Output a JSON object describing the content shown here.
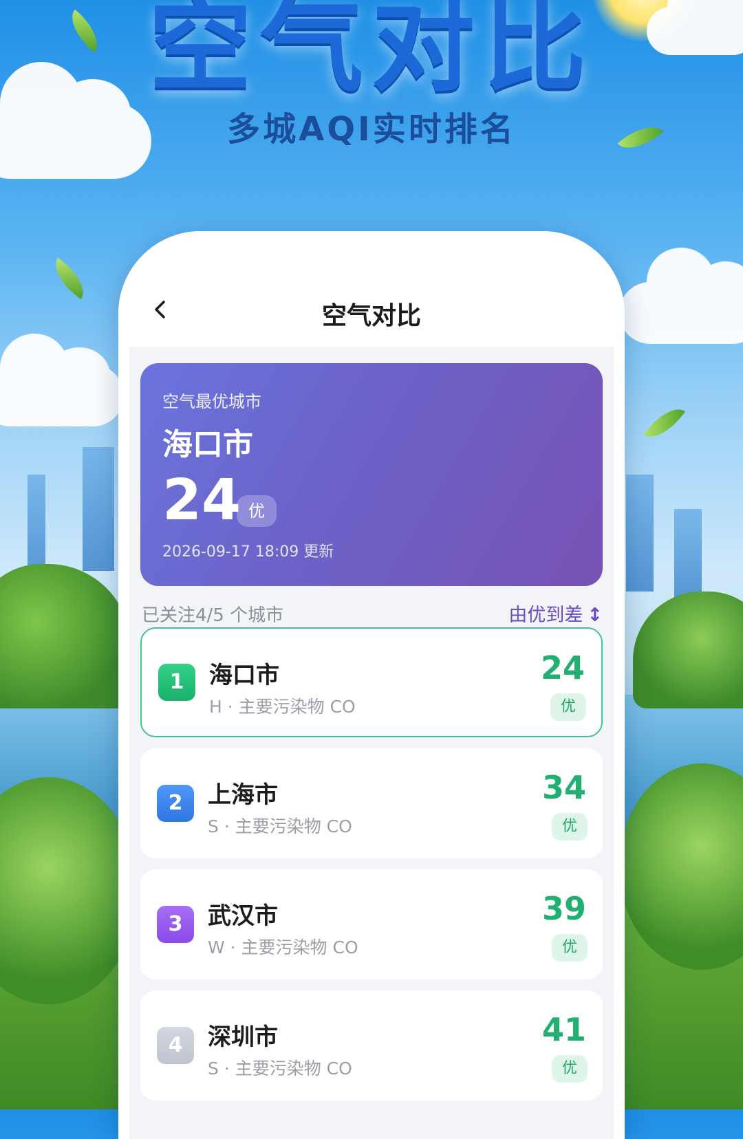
{
  "poster": {
    "title": "空气对比",
    "subtitle": "多城AQI实时排名"
  },
  "nav": {
    "title": "空气对比"
  },
  "best_city_card": {
    "label": "空气最优城市",
    "city": "海口市",
    "aqi": "24",
    "level": "优",
    "updated": "2026-09-17 18:09 更新"
  },
  "list_header": {
    "count_text": "已关注4/5 个城市",
    "sort_label": "由优到差",
    "sort_icon": "↕"
  },
  "colors": {
    "accent_purple": "#6a4cc4",
    "good_green": "#22b070",
    "rank1": "#22c27a",
    "rank2": "#3b86f0",
    "rank3": "#9a5cf0",
    "rank4": "#c7ccd6"
  },
  "cities": [
    {
      "rank": "1",
      "name": "海口市",
      "detail": "H · 主要污染物 CO",
      "aqi": "24",
      "level": "优"
    },
    {
      "rank": "2",
      "name": "上海市",
      "detail": "S · 主要污染物 CO",
      "aqi": "34",
      "level": "优"
    },
    {
      "rank": "3",
      "name": "武汉市",
      "detail": "W · 主要污染物 CO",
      "aqi": "39",
      "level": "优"
    },
    {
      "rank": "4",
      "name": "深圳市",
      "detail": "S · 主要污染物 CO",
      "aqi": "41",
      "level": "优"
    }
  ]
}
